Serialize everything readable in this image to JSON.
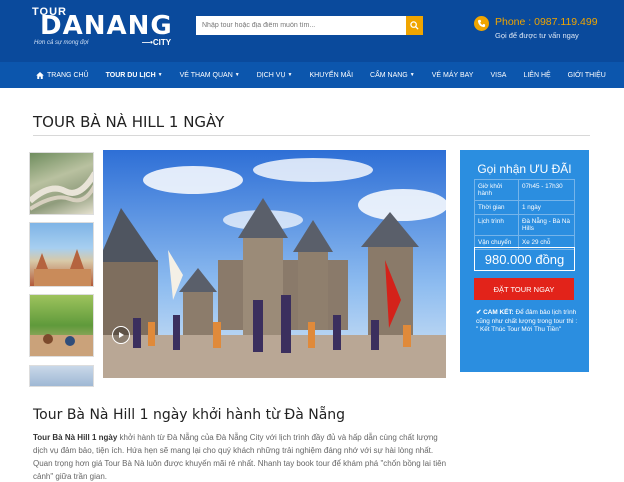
{
  "header": {
    "logo_tour": "TOUR",
    "logo_brand": "DANANG",
    "logo_slogan": "Hơn cả sự mong đợi",
    "logo_city": "CITY",
    "search_placeholder": "Nhập tour hoặc địa điểm muốn tìm...",
    "phone_label": "Phone : 0987.119.499",
    "phone_sub": "Gọi để được tư vấn ngay"
  },
  "nav": {
    "items": [
      {
        "label": "TRANG CHỦ",
        "caret": false
      },
      {
        "label": "TOUR DU LỊCH",
        "caret": true
      },
      {
        "label": "VÉ THAM QUAN",
        "caret": true
      },
      {
        "label": "DỊCH VỤ",
        "caret": true
      },
      {
        "label": "KHUYẾN MÃI",
        "caret": false
      },
      {
        "label": "CẨM NANG",
        "caret": true
      },
      {
        "label": "VÉ MÁY BAY",
        "caret": false
      },
      {
        "label": "VISA",
        "caret": false
      },
      {
        "label": "LIÊN HỆ",
        "caret": false
      },
      {
        "label": "GIỚI THIỆU",
        "caret": false
      }
    ]
  },
  "page": {
    "title": "TOUR BÀ NÀ HILL 1 NGÀY"
  },
  "booking": {
    "title": "Gọi nhận ƯU ĐÃI",
    "rows": [
      {
        "key": "Giờ khởi hành",
        "value": "07h45 - 17h30"
      },
      {
        "key": "Thời gian",
        "value": "1 ngày"
      },
      {
        "key": "Lịch trình",
        "value": "Đà Nẵng - Bà Nà Hills"
      },
      {
        "key": "Vận chuyển",
        "value": "Xe 29 chỗ"
      }
    ],
    "price": "980.000 đồng",
    "book_label": "ĐẶT TOUR NGAY",
    "commit_title": "✔ CAM KẾT:",
    "commit_text": " Để đảm bảo lịch trình cũng như chất lượng trong tour thì : \" Kết Thúc Tour Mới Thu Tiền\""
  },
  "article": {
    "heading": "Tour Bà Nà Hill 1 ngày khởi hành từ Đà Nẵng",
    "lead": "Tour Bà Nà Hill 1 ngày",
    "body": " khởi hành từ Đà Nẵng của Đà Nẵng City với lịch trình đầy đủ và hấp dẫn cùng chất lượng dịch vụ đảm bảo, tiện ích. Hứa hẹn sẽ mang lại cho quý khách những trải nghiệm đáng nhớ với sự hài lòng nhất. Quan trọng hơn giá Tour Bà Nà luôn được khuyến mãi rẻ nhất. Nhanh tay book tour để khám phá \"chốn bồng lai tiên cảnh\" giữa trần gian."
  },
  "colors": {
    "header_bg": "#0a4a9c",
    "nav_bg": "#0c56ad",
    "accent": "#f0a500",
    "panel_bg": "#2b8ee0",
    "book_button": "#e2231a"
  }
}
